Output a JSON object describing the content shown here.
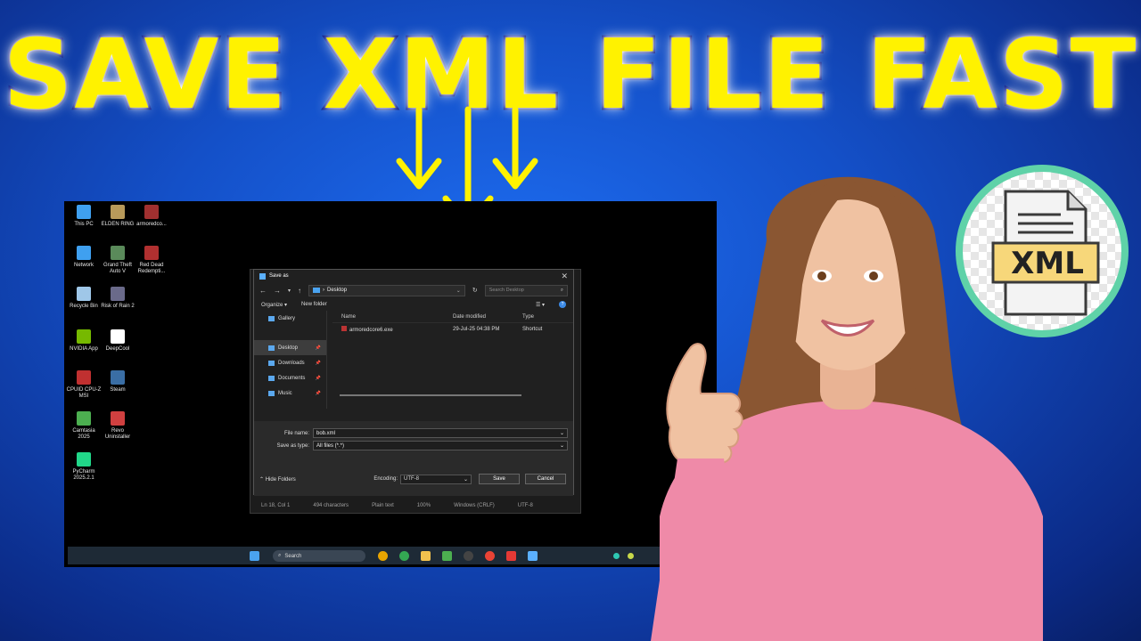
{
  "headline": "SAVE XML FILE FAST",
  "colors": {
    "headline_fill": "#fff200",
    "headline_stroke": "#0a1a8a",
    "background": "#1450c8",
    "badge_ring": "#5fd2a8"
  },
  "desktop_icons": [
    {
      "label": "This PC",
      "icon": "monitor-icon",
      "color": "#3fa0f0"
    },
    {
      "label": "ELDEN RING",
      "icon": "game-icon",
      "color": "#b89a5a"
    },
    {
      "label": "armoredco...",
      "icon": "game-icon",
      "color": "#a03030"
    },
    {
      "label": "Network",
      "icon": "network-icon",
      "color": "#3fa0f0"
    },
    {
      "label": "Grand Theft Auto V",
      "icon": "game-icon",
      "color": "#5a8a5a"
    },
    {
      "label": "Red Dead Redempti...",
      "icon": "game-icon",
      "color": "#b03030"
    },
    {
      "label": "Recycle Bin",
      "icon": "recycle-bin-icon",
      "color": "#9fc7e8"
    },
    {
      "label": "Risk of Rain 2",
      "icon": "game-icon",
      "color": "#6a6a8a"
    },
    {
      "label": "NVIDIA App",
      "icon": "nvidia-icon",
      "color": "#76b900"
    },
    {
      "label": "DeepCool",
      "icon": "fan-icon",
      "color": "#ffffff"
    },
    {
      "label": "CPUID CPU-Z MSI",
      "icon": "cpu-icon",
      "color": "#c03030"
    },
    {
      "label": "Steam",
      "icon": "steam-icon",
      "color": "#3a6ea5"
    },
    {
      "label": "Camtasia 2025",
      "icon": "camtasia-icon",
      "color": "#4caf50"
    },
    {
      "label": "Revo Uninstaller",
      "icon": "revo-icon",
      "color": "#d04040"
    },
    {
      "label": "PyCharm 2025.2.1",
      "icon": "pycharm-icon",
      "color": "#21d789"
    }
  ],
  "dialog": {
    "title": "Save as",
    "address": "Desktop",
    "search_placeholder": "Search Desktop",
    "organize": "Organize",
    "new_folder": "New folder",
    "nav": [
      {
        "label": "Gallery",
        "icon": "gallery-icon",
        "pinned": false
      },
      {
        "label": "Desktop",
        "icon": "desktop-icon",
        "pinned": true
      },
      {
        "label": "Downloads",
        "icon": "download-icon",
        "pinned": true
      },
      {
        "label": "Documents",
        "icon": "documents-icon",
        "pinned": true
      },
      {
        "label": "Music",
        "icon": "music-icon",
        "pinned": true
      }
    ],
    "columns": {
      "name": "Name",
      "date": "Date modified",
      "type": "Type"
    },
    "files": [
      {
        "name": "armoredcore6.exe",
        "date": "29-Jul-25 04:38 PM",
        "type": "Shortcut"
      }
    ],
    "file_name_label": "File name:",
    "file_name_value": "bob.xml",
    "save_as_type_label": "Save as type:",
    "save_as_type_value": "All files (*.*)",
    "hide_folders": "Hide Folders",
    "encoding_label": "Encoding:",
    "encoding_value": "UTF-8",
    "save": "Save",
    "cancel": "Cancel"
  },
  "editor_status": [
    "Ln 18, Col 1",
    "494 characters",
    "Plain text",
    "100%",
    "Windows (CRLF)",
    "UTF-8"
  ],
  "taskbar": {
    "search_placeholder": "Search"
  },
  "badge": {
    "label": "XML"
  }
}
